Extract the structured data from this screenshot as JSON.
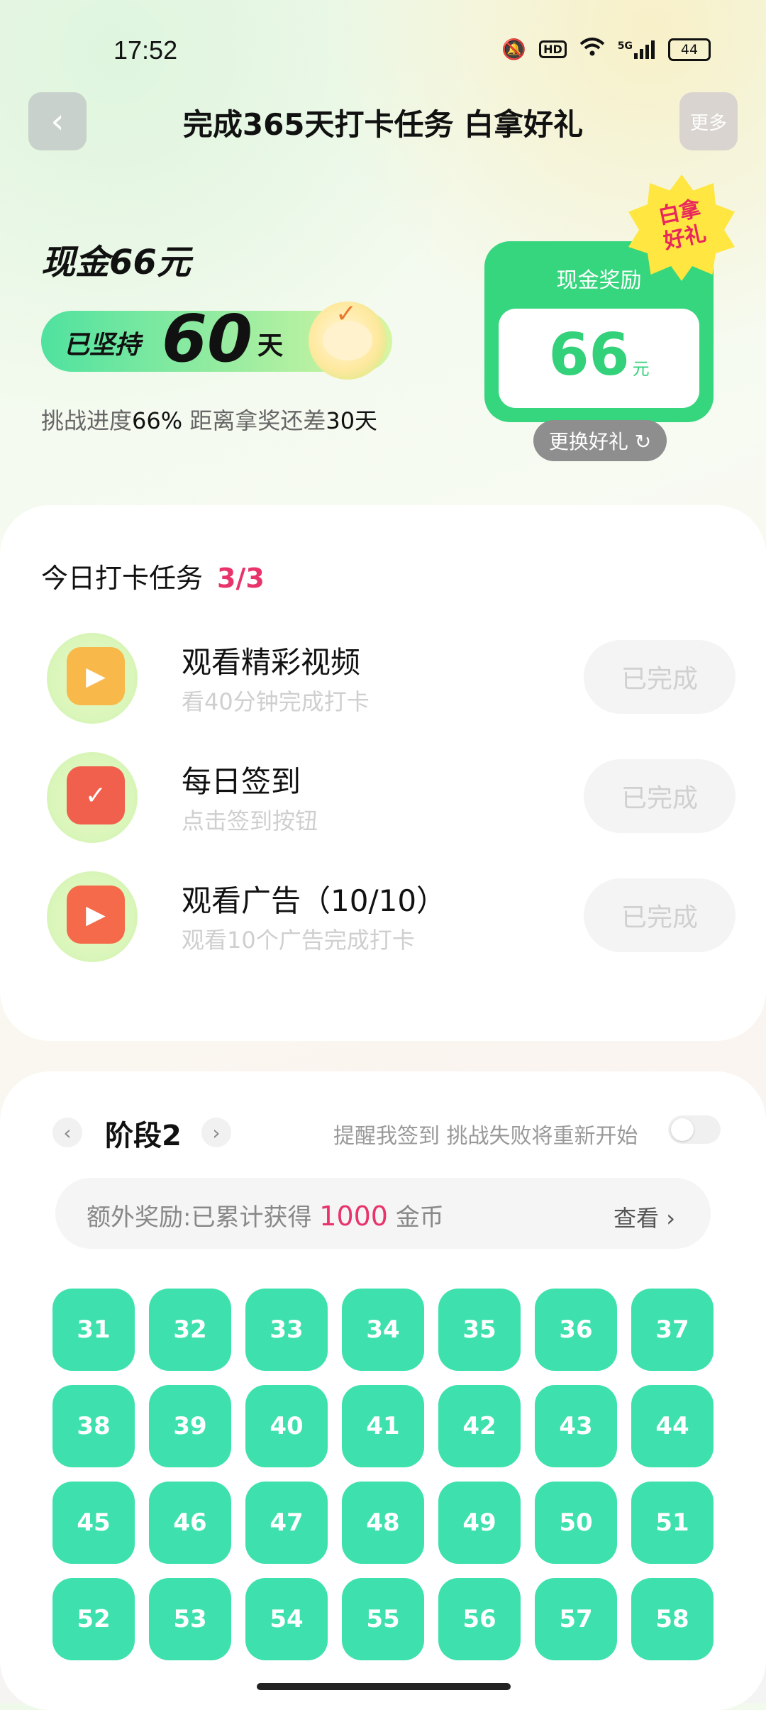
{
  "status_bar": {
    "time": "17:52",
    "hd": "HD",
    "network": "5G",
    "battery": "44"
  },
  "nav": {
    "back_icon": "‹",
    "title": "完成365天打卡任务 白拿好礼",
    "more_label": "更多"
  },
  "summary": {
    "cash_title": "现金66元",
    "persist_label": "已坚持",
    "persist_days": "60",
    "persist_unit": "天",
    "progress_prefix": "挑战进度",
    "progress_pct": "66%",
    "progress_mid": " 距离拿奖还差",
    "remaining_days": "30天"
  },
  "reward": {
    "label": "现金奖励",
    "amount": "66",
    "unit": "元",
    "badge_line1": "白拿",
    "badge_line2": "好礼",
    "swap_label": "更换好礼 ↻"
  },
  "today_tasks": {
    "title": "今日打卡任务",
    "count": "3/3",
    "items": [
      {
        "name": "观看精彩视频",
        "sub": "看40分钟完成打卡",
        "status": "已完成",
        "icon": "video-icon",
        "color": "#f8b84a"
      },
      {
        "name": "每日签到",
        "sub": "点击签到按钮",
        "status": "已完成",
        "icon": "calendar-check-icon",
        "color": "#f0604c"
      },
      {
        "name": "观看广告（10/10）",
        "sub": "观看10个广告完成打卡",
        "status": "已完成",
        "icon": "ad-play-icon",
        "color": "#f46a4a"
      }
    ]
  },
  "stage": {
    "label": "阶段2",
    "prev_icon": "‹",
    "next_icon": "›",
    "remind_text": "提醒我签到 挑战失败将重新开始",
    "extra_prefix": "额外奖励:已累计获得 ",
    "extra_coins": "1000",
    "extra_suffix": " 金币",
    "view_label": "查看 ›",
    "days": [
      "31",
      "32",
      "33",
      "34",
      "35",
      "36",
      "37",
      "38",
      "39",
      "40",
      "41",
      "42",
      "43",
      "44",
      "45",
      "46",
      "47",
      "48",
      "49",
      "50",
      "51",
      "52",
      "53",
      "54",
      "55",
      "56",
      "57",
      "58"
    ]
  },
  "colors": {
    "accent_green": "#35d67d",
    "day_teal": "#3ee1ad",
    "highlight_pink": "#e8336b"
  }
}
